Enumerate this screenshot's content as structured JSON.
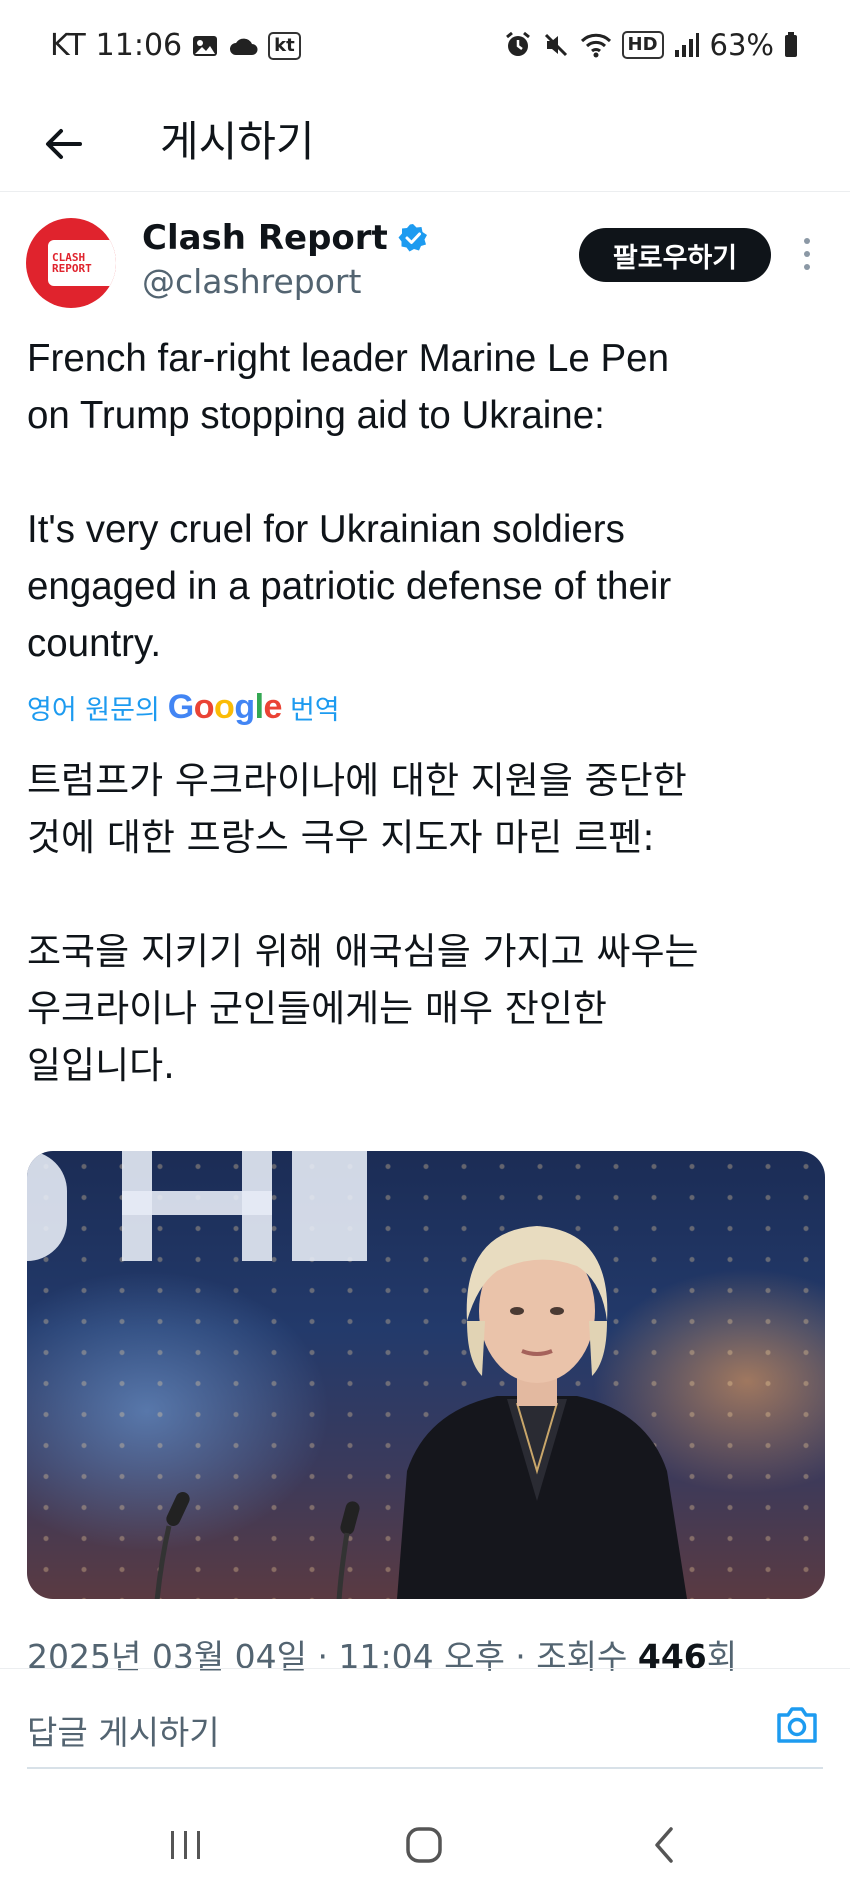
{
  "status_bar": {
    "carrier": "KT",
    "time": "11:06",
    "kt_badge": "kt",
    "hd_badge": "HD",
    "battery": "63%"
  },
  "header": {
    "title": "게시하기"
  },
  "tweet": {
    "author": {
      "display_name": "Clash Report",
      "handle": "@clashreport",
      "avatar_text_line1": "CLASH",
      "avatar_text_line2": "REPORT",
      "verified": true
    },
    "follow_label": "팔로우하기",
    "text_lines": [
      "French far-right leader Marine Le Pen",
      "on Trump stopping aid to Ukraine:",
      "",
      "It's very cruel for Ukrainian soldiers",
      "engaged in a patriotic defense of their",
      "country."
    ],
    "translation_prefix": "영어 원문의",
    "translation_brand": "Google",
    "translation_suffix": "번역",
    "translated_lines": [
      "트럼프가 우크라이나에 대한 지원을 중단한",
      "것에 대한 프랑스 극우 지도자 마린 르펜:",
      "",
      "조국을 지키기 위해 애국심을 가지고 싸우는",
      "우크라이나 군인들에게는 매우 잔인한",
      "일입니다."
    ],
    "meta_prefix": "2025년 03월 04일 · 11:04 오후 · 조회수",
    "views": "446",
    "views_suffix": "회"
  },
  "reply": {
    "placeholder": "답글 게시하기"
  },
  "colors": {
    "accent": "#1d9bf0",
    "follow_bg": "#0f1419",
    "avatar_bg": "#e0232d",
    "secondary_text": "#536471"
  },
  "icons": {
    "back": "arrow-left-icon",
    "verified": "verified-badge-icon",
    "more": "more-vertical-icon",
    "camera": "camera-icon",
    "recents": "recents-icon",
    "home": "home-icon",
    "nav_back": "nav-back-icon"
  }
}
